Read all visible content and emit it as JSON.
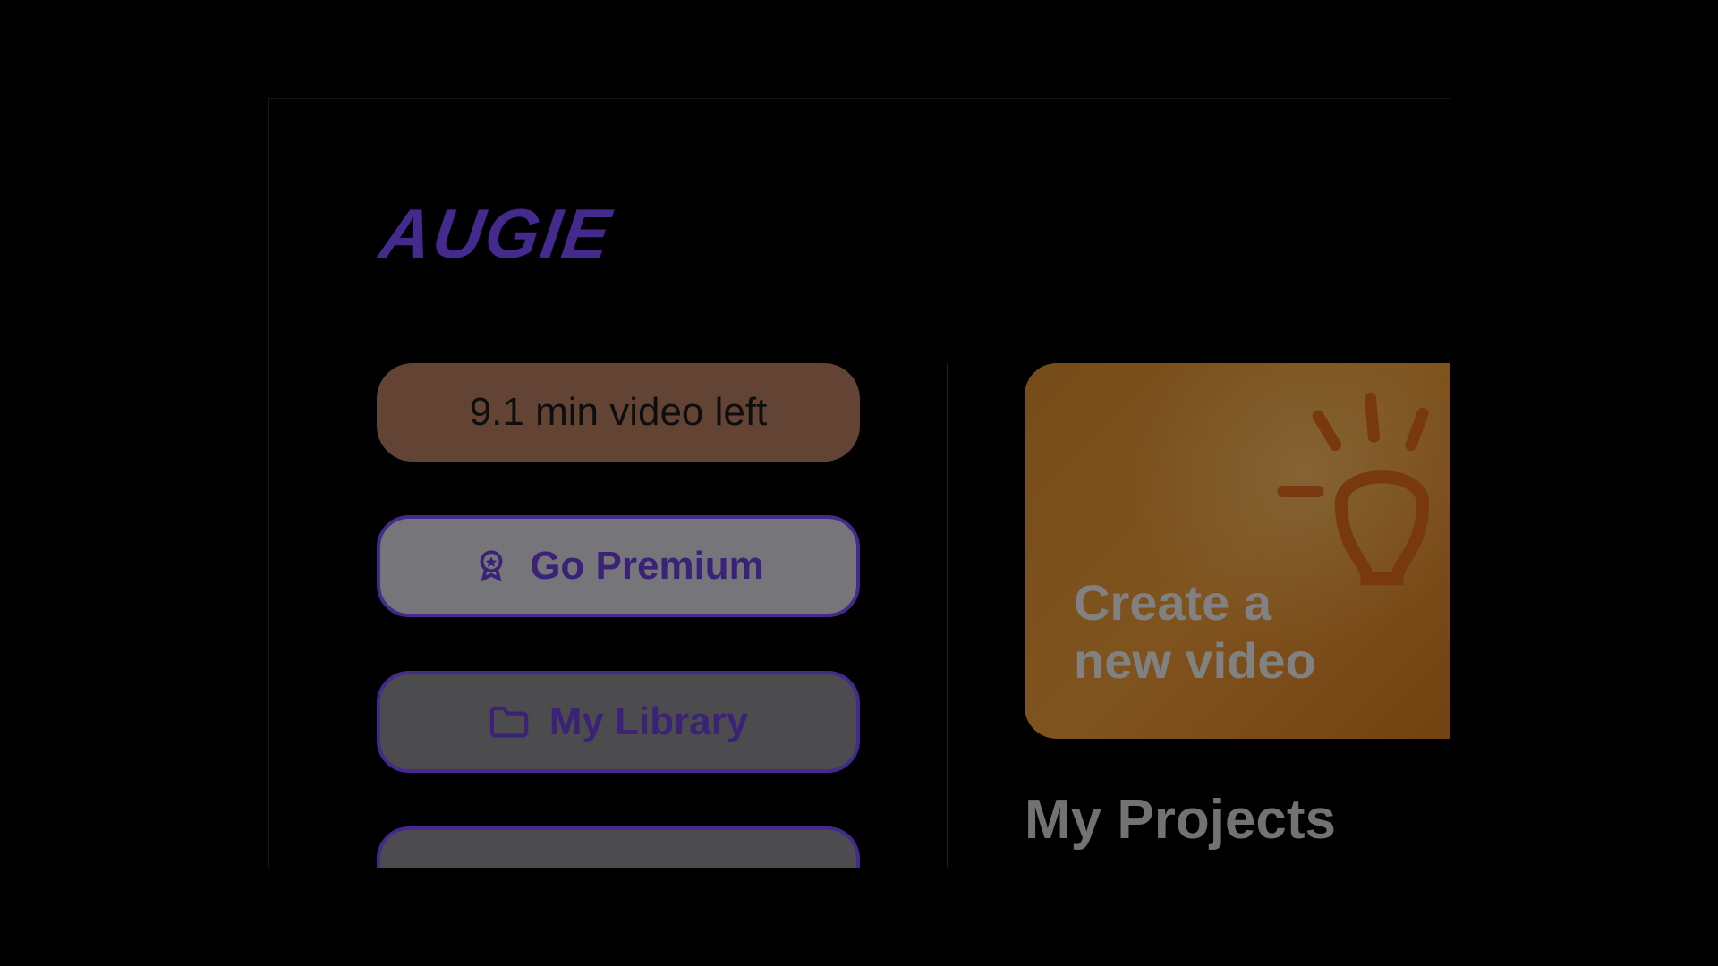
{
  "brand": {
    "logo_text": "AUGIE",
    "primary_color": "#7c4dff"
  },
  "sidebar": {
    "quota_label": "9.1 min video left",
    "go_premium_label": "Go Premium",
    "my_library_label": "My Library"
  },
  "main": {
    "create_card_line1": "Create a",
    "create_card_line2": "new video",
    "projects_heading": "My Projects"
  },
  "colors": {
    "quota_bg": "#b37a5f",
    "premium_bg": "#d8d6dc",
    "library_bg": "#8a8a8f",
    "accent": "#6b3fd9",
    "card_orange": "#e89838"
  }
}
